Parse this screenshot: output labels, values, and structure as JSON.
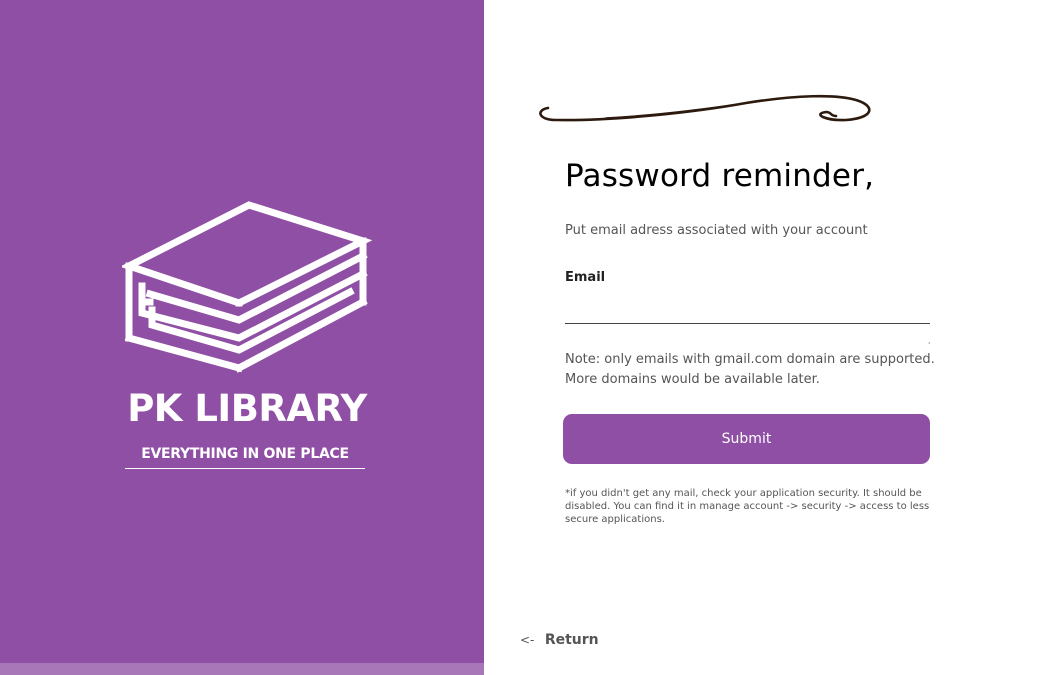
{
  "brand": {
    "title": "PK LIBRARY",
    "tagline": "EVERYTHING IN ONE PLACE",
    "logo_icon": "stacked-books-icon",
    "panel_color": "#8f4fa5"
  },
  "form": {
    "title": "Password reminder,",
    "subtitle": "Put email adress associated with your account",
    "email_label": "Email",
    "email_value": "",
    "email_placeholder": "",
    "tick_mark": ",",
    "note_lines": [
      "Note: only emails with gmail.com domain are supported.",
      "More domains would be available later."
    ],
    "submit_label": "Submit",
    "footnote_lines": [
      "*if you didn't get any mail, check your application security. It should be",
      "disabled. You can find it in manage account -> security -> access to less",
      "secure applications."
    ]
  },
  "navigation": {
    "return_arrow": "<-",
    "return_label": "Return"
  },
  "colors": {
    "accent": "#8f4fa5",
    "accent_light": "#a777b8",
    "flourish": "#2d1a0e"
  }
}
